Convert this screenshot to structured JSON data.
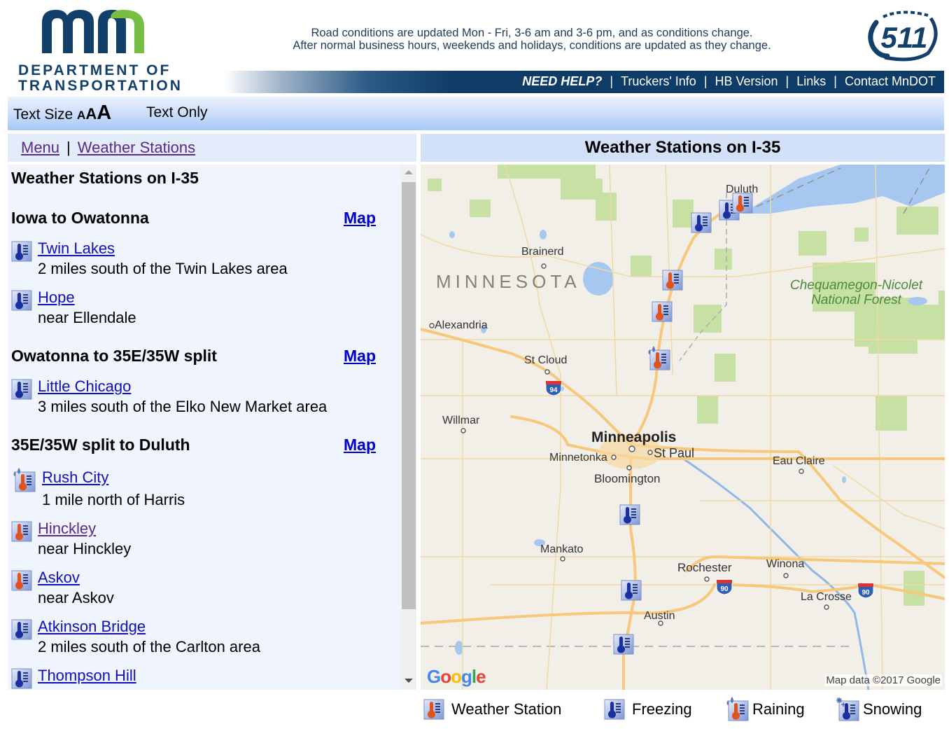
{
  "header": {
    "logo_mark": "mn",
    "logo_line1": "DEPARTMENT OF",
    "logo_line2": "TRANSPORTATION",
    "notice_line1": "Road conditions are updated Mon - Fri, 3-6 am and 3-6 pm, and as conditions change.",
    "notice_line2": "After normal business hours, weekends and holidays, conditions are updated as they change.",
    "badge": "511",
    "nav": {
      "help": "NEED HELP?",
      "links": [
        "Truckers' Info",
        "HB Version",
        "Links",
        "Contact MnDOT"
      ],
      "separator": "|"
    }
  },
  "toolbar": {
    "text_size_label": "Text Size",
    "size_small": "A",
    "size_medium": "A",
    "size_large": "A",
    "text_only": "Text Only"
  },
  "breadcrumb": {
    "menu": "Menu",
    "separator": "|",
    "current": "Weather Stations"
  },
  "list": {
    "title": "Weather Stations on I-35",
    "sections": [
      {
        "title": "Iowa to Owatonna",
        "map_link": "Map",
        "stations": [
          {
            "name": "Twin Lakes",
            "desc": "2 miles south of the Twin Lakes area",
            "status": "freezing"
          },
          {
            "name": "Hope",
            "desc": "near Ellendale",
            "status": "freezing"
          }
        ]
      },
      {
        "title": "Owatonna to 35E/35W split",
        "map_link": "Map",
        "stations": [
          {
            "name": "Little Chicago",
            "desc": "3 miles south of the Elko New Market area",
            "status": "freezing"
          }
        ]
      },
      {
        "title": "35E/35W split to Duluth",
        "map_link": "Map",
        "stations": [
          {
            "name": "Rush City",
            "desc": "1 mile north of Harris",
            "status": "raining"
          },
          {
            "name": "Hinckley",
            "desc": "near Hinckley",
            "status": "normal",
            "visited": true
          },
          {
            "name": "Askov",
            "desc": "near Askov",
            "status": "normal"
          },
          {
            "name": "Atkinson Bridge",
            "desc": "2 miles south of the Carlton area",
            "status": "freezing"
          },
          {
            "name": "Thompson Hill",
            "desc": "",
            "status": "freezing"
          }
        ]
      }
    ]
  },
  "map": {
    "title": "Weather Stations on I-35",
    "labels": {
      "state": "MINNESOTA",
      "duluth": "Duluth",
      "brainerd": "Brainerd",
      "alexandria": "Alexandria",
      "st_cloud": "St Cloud",
      "willmar": "Willmar",
      "minneapolis": "Minneapolis",
      "st_paul": "St Paul",
      "minnetonka": "Minnetonka",
      "bloomington": "Bloomington",
      "eau_claire": "Eau Claire",
      "mankato": "Mankato",
      "rochester": "Rochester",
      "winona": "Winona",
      "la_crosse": "La Crosse",
      "austin": "Austin",
      "forest_line1": "Chequamegon-Nicolet",
      "forest_line2": "National Forest"
    },
    "shields": {
      "i94": "94",
      "i90": "90"
    },
    "google": "Google",
    "attribution": "Map data ©2017 Google"
  },
  "legend": {
    "normal": "Weather Station",
    "freezing": "Freezing",
    "raining": "Raining",
    "snowing": "Snowing"
  },
  "colors": {
    "navy": "#0f3c67",
    "link": "#1010c0",
    "visited": "#5b2a86",
    "logo_green": "#78be43",
    "thermo_warm": "#e0531c",
    "thermo_cold": "#1c2f9e"
  }
}
